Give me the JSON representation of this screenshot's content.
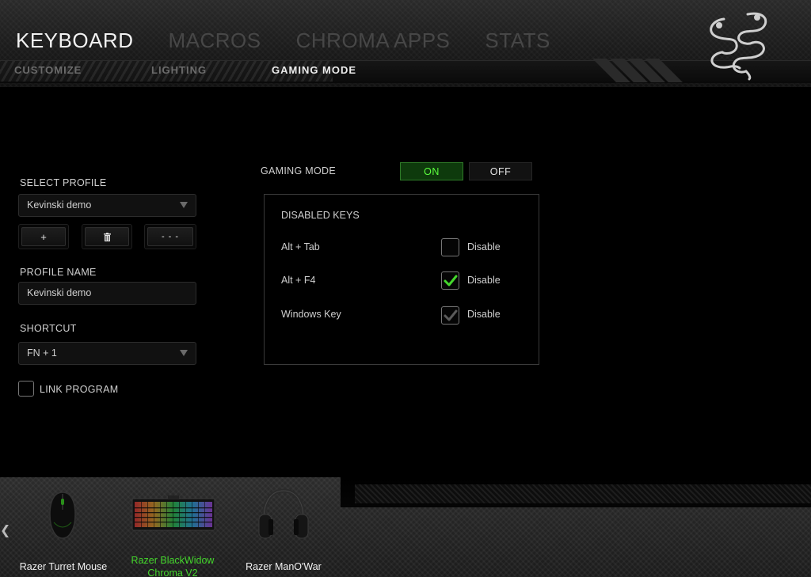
{
  "header": {
    "main_tabs": [
      "KEYBOARD",
      "MACROS",
      "CHROMA APPS",
      "STATS"
    ],
    "sub_tabs": [
      "CUSTOMIZE",
      "LIGHTING",
      "GAMING MODE"
    ]
  },
  "profile": {
    "select_label": "SELECT PROFILE",
    "selected_profile": "Kevinski demo",
    "add_label": "+",
    "more_label": "- - -",
    "name_label": "PROFILE NAME",
    "name_value": "Kevinski demo",
    "shortcut_label": "SHORTCUT",
    "shortcut_value": "FN + 1",
    "link_program_label": "LINK PROGRAM"
  },
  "gaming_mode": {
    "label": "GAMING MODE",
    "on_label": "ON",
    "off_label": "OFF",
    "state": "on"
  },
  "disabled_keys": {
    "title": "DISABLED KEYS",
    "rows": [
      {
        "key": "Alt + Tab",
        "label": "Disable",
        "checked": false
      },
      {
        "key": "Alt + F4",
        "label": "Disable",
        "checked": true
      },
      {
        "key": "Windows Key",
        "label": "Disable",
        "checked": true
      }
    ]
  },
  "devices": [
    {
      "name": "Razer Turret Mouse",
      "active": false
    },
    {
      "name_line1": "Razer BlackWidow",
      "name_line2": "Chroma V2",
      "active": true
    },
    {
      "name": "Razer ManO'War",
      "active": false
    }
  ],
  "colors": {
    "accent_green": "#44d62c",
    "toggle_on_bg": "#0e3a0c",
    "background": "#000000"
  }
}
